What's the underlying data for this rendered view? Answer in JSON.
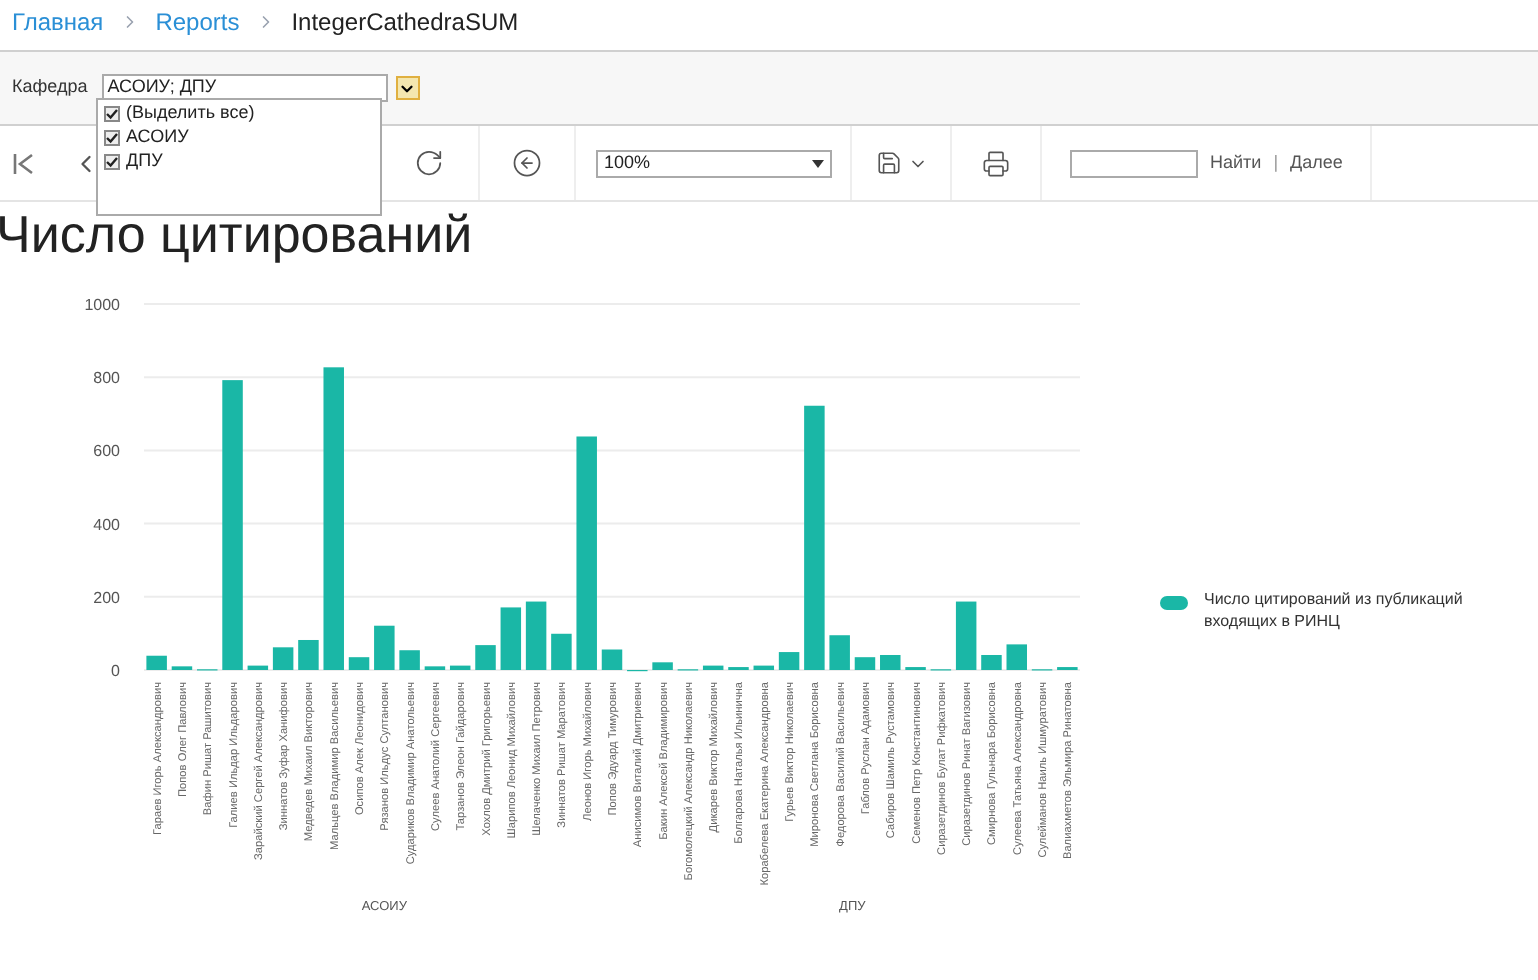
{
  "breadcrumb": [
    {
      "label": "Главная",
      "kind": "link"
    },
    {
      "label": "Reports",
      "kind": "link"
    },
    {
      "label": "IntegerCathedraSUM",
      "kind": "current"
    }
  ],
  "parameter": {
    "label": "Кафедра",
    "value": "АСОИУ; ДПУ",
    "expanded": true,
    "options": [
      {
        "label": "(Выделить все)",
        "checked": true
      },
      {
        "label": "АСОИУ",
        "checked": true
      },
      {
        "label": "ДПУ",
        "checked": true
      }
    ]
  },
  "toolbar": {
    "zoom": "100%",
    "search_button": "Найти",
    "separator": "|",
    "next_button": "Далее"
  },
  "report_title": "Число цитирований",
  "chart": {
    "groups": [
      {
        "label": "АСОИУ"
      },
      {
        "label": "ДПУ"
      }
    ],
    "chart_data": {
      "type": "bar",
      "grid": true,
      "ylim": [
        0,
        1000
      ],
      "yticks": [
        0,
        200,
        400,
        600,
        800,
        1000
      ],
      "categories": [
        "Гараев Игорь Александрович",
        "Попов Олег Павлович",
        "Вафин Ришат Рашитович",
        "Галиев Ильдар Ильдарович",
        "Зарайский Сергей Александрович",
        "Зиннатов Зуфар Ханифович",
        "Медведев Михаил Викторович",
        "Мальцев Владимир Васильевич",
        "Осипов Алек Леонидович",
        "Рязанов Ильдус Султанович",
        "Судариков Владимир Анатольевич",
        "Сулеев Анатолий Сергеевич",
        "Тарзанов Элеон Гайдарович",
        "Хохлов Дмитрий Григорьевич",
        "Шарипов Леонид Михайлович",
        "Шелаченко Михаил Петрович",
        "Зиннатов Ришат Маратович",
        "Леонов Игорь Михайлович",
        "Попов Эдуард Тимурович",
        "Анисимов Виталий Дмитриевич",
        "Бакин Алексей Владимирович",
        "Богомолецкий Александр Николаевич",
        "Дикарев Виктор Михайлович",
        "Болгарова Наталья Ильинична",
        "Корабелева Екатерина Александровна",
        "Гурьев Виктор Николаевич",
        "Миронова Светлана Борисовна",
        "Федорова Василий Васильевич",
        "Габлов Руслан Адамович",
        "Сабиров Шамиль Рустамович",
        "Семенов Петр Константинович",
        "Сиразетдинов Булат Рифкатович",
        "Сиразетдинов Ринат Вагизович",
        "Смирнова Гульнара Борисовна",
        "Сулеева Татьяна Александровна",
        "Сулейманов Наиль Ишмуратович",
        "Валиахметов Эльмира Ринатовна"
      ],
      "series": [
        {
          "name": "Число цитирований из публикаций входящих в РИНЦ",
          "color": "#1ab7a6",
          "values": [
            39,
            10,
            2,
            792,
            12,
            62,
            82,
            827,
            35,
            121,
            54,
            10,
            12,
            68,
            171,
            187,
            99,
            638,
            56,
            0,
            21,
            2,
            12,
            8,
            12,
            49,
            722,
            95,
            35,
            41,
            8,
            2,
            187,
            41,
            70,
            2,
            8
          ]
        }
      ]
    }
  }
}
